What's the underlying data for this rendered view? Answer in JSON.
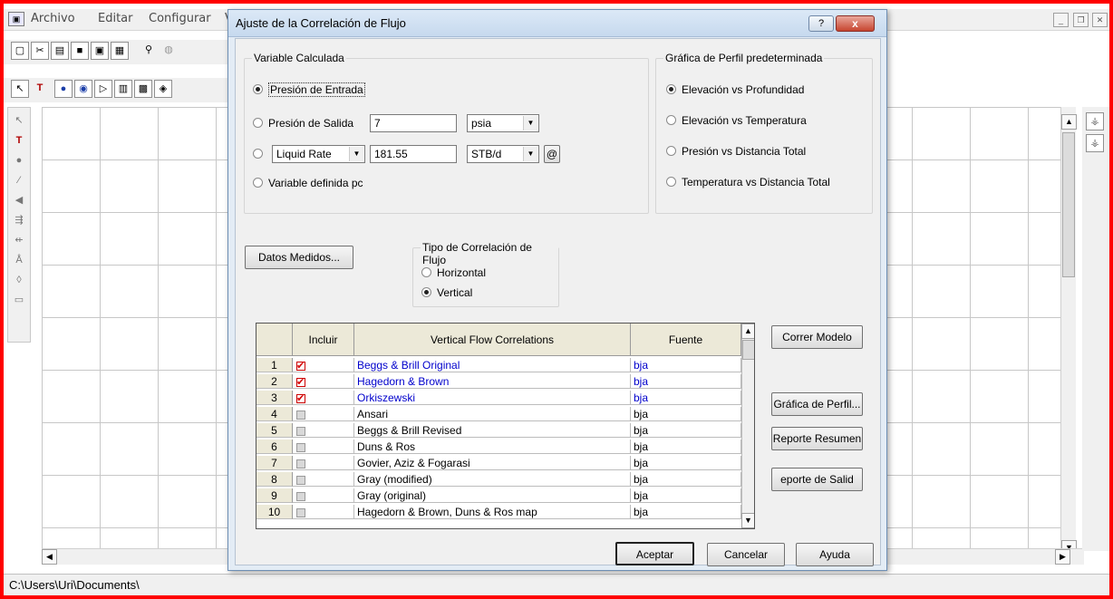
{
  "app": {
    "menu": [
      "Archivo",
      "Editar",
      "Configurar",
      "V"
    ],
    "status_path": "C:\\Users\\Uri\\Documents\\"
  },
  "dialog": {
    "title": "Ajuste de la Correlación de Flujo",
    "help_btn": "?",
    "close_btn": "x",
    "variable_group": {
      "title": "Variable Calculada",
      "presion_entrada": "Presión de Entrada",
      "presion_salida": "Presión de Salida",
      "presion_salida_value": "7",
      "presion_salida_unit": "psia",
      "liquid_rate_selector": "Liquid Rate",
      "liquid_rate_value": "181.55",
      "liquid_rate_unit": "STB/d",
      "at_symbol": "@",
      "variable_definida": "Variable definida pc"
    },
    "grafica_group": {
      "title": "Gráfica de Perfil predeterminada",
      "options": [
        "Elevación vs Profundidad",
        "Elevación vs Temperatura",
        "Presión vs Distancia Total",
        "Temperatura vs Distancia Total"
      ]
    },
    "datos_medidos": "Datos Medidos...",
    "tipo_group": {
      "title": "Tipo de Correlación de Flujo",
      "horizontal": "Horizontal",
      "vertical": "Vertical"
    },
    "grid": {
      "headers": [
        "Incluir",
        "Vertical Flow Correlations",
        "Fuente"
      ],
      "rows": [
        {
          "num": "1",
          "checked": true,
          "name": "Beggs & Brill Original",
          "source": "bja"
        },
        {
          "num": "2",
          "checked": true,
          "name": "Hagedorn & Brown",
          "source": "bja"
        },
        {
          "num": "3",
          "checked": true,
          "name": "Orkiszewski",
          "source": "bja"
        },
        {
          "num": "4",
          "checked": false,
          "name": "Ansari",
          "source": "bja"
        },
        {
          "num": "5",
          "checked": false,
          "name": "Beggs & Brill Revised",
          "source": "bja"
        },
        {
          "num": "6",
          "checked": false,
          "name": "Duns & Ros",
          "source": "bja"
        },
        {
          "num": "7",
          "checked": false,
          "name": "Govier, Aziz & Fogarasi",
          "source": "bja"
        },
        {
          "num": "8",
          "checked": false,
          "name": "Gray (modified)",
          "source": "bja"
        },
        {
          "num": "9",
          "checked": false,
          "name": "Gray (original)",
          "source": "bja"
        },
        {
          "num": "10",
          "checked": false,
          "name": "Hagedorn & Brown, Duns & Ros map",
          "source": "bja"
        }
      ]
    },
    "side_buttons": {
      "correr_modelo": "Correr Modelo",
      "grafica_perfil": "Gráfica de Perfil...",
      "reporte_resumen": "Reporte Resumen",
      "reporte_salida": "eporte de Salid"
    },
    "footer": {
      "aceptar": "Aceptar",
      "cancelar": "Cancelar",
      "ayuda": "Ayuda"
    },
    "colors": {
      "checked_row_text": "#0000cc",
      "check_mark": "#d40000",
      "frame_border": "#ff0000"
    }
  }
}
